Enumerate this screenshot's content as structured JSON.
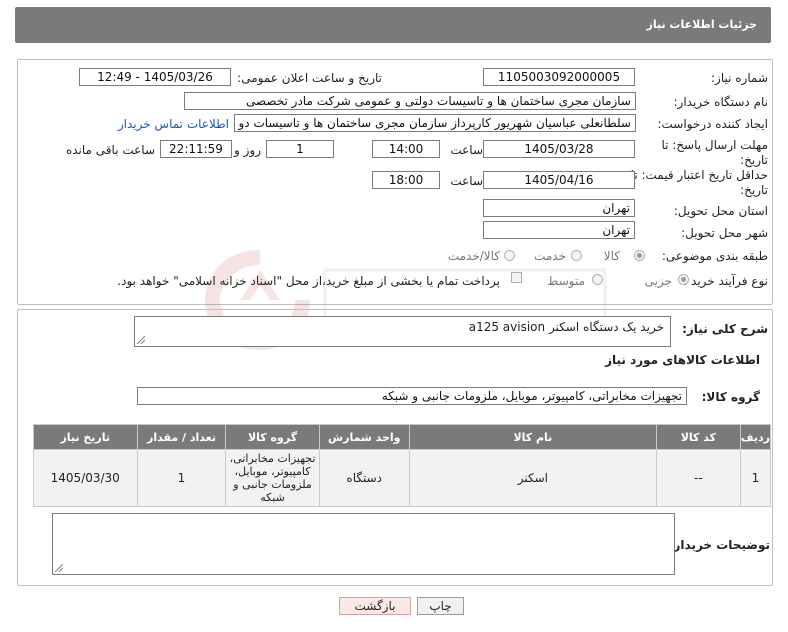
{
  "header": {
    "title": "جزئیات اطلاعات نیاز"
  },
  "fields": {
    "need_number_label": "شماره نیاز:",
    "need_number": "1105003092000005",
    "announce_label": "تاریخ و ساعت اعلان عمومی:",
    "announce_value": "1405/03/26 - 12:49",
    "buyer_label": "نام دستگاه خریدار:",
    "buyer_value": "سازمان مجری ساختمان ها و تاسیسات دولتی و عمومی  شرکت مادر تخصصی",
    "creator_label": "ایجاد کننده درخواست:",
    "creator_value": "سلطانعلی عباسیان شهریور کارپرداز سازمان مجری ساختمان ها و تاسیسات دو",
    "contact_link": "اطلاعات تماس خریدار",
    "deadline_label": "مهلت ارسال پاسخ: تا تاریخ:",
    "deadline_date": "1405/03/28",
    "time_label": "ساعت",
    "deadline_time": "14:00",
    "days_value": "1",
    "day_and_label": "روز و",
    "remaining_time": "22:11:59",
    "remaining_label": "ساعت باقی مانده",
    "validity_label": "حداقل تاریخ اعتبار قیمت: تا تاریخ:",
    "validity_date": "1405/04/16",
    "validity_time": "18:00",
    "province_label": "استان محل تحویل:",
    "province_value": "تهران",
    "city_label": "شهر محل تحویل:",
    "city_value": "تهران",
    "category_label": "طبقه بندی موضوعی:",
    "category_opt1": "کالا",
    "category_opt2": "خدمت",
    "category_opt3": "کالا/خدمت",
    "process_label": "نوع فرآیند خرید :",
    "process_opt1": "جزیی",
    "process_opt2": "متوسط",
    "payment_note": "پرداخت تمام یا بخشی از مبلغ خرید،از محل \"اسناد خزانه اسلامی\" خواهد بود."
  },
  "summary": {
    "label": "شرح کلی نیاز:",
    "value": "خرید یک دستگاه اسکنر a125 avision"
  },
  "goods_info_title": "اطلاعات کالاهای مورد نیاز",
  "goods_group": {
    "label": "گروه کالا:",
    "value": "تجهیزات مخابراتی، کامپیوتر، موبایل، ملزومات جانبی و شبکه"
  },
  "table": {
    "headers": [
      "ردیف",
      "کد کالا",
      "نام کالا",
      "واحد شمارش",
      "گروه کالا",
      "تعداد / مقدار",
      "تاریخ نیاز"
    ],
    "rows": [
      [
        "1",
        "--",
        "اسکنر",
        "دستگاه",
        "تجهیزات مخابراتی، کامپیوتر، موبایل، ملزومات جانبی و شبکه",
        "1",
        "1405/03/30"
      ]
    ]
  },
  "buyer_notes_label": "توضیحات خریدار:",
  "buttons": {
    "print": "چاپ",
    "back": "بازگشت"
  },
  "watermark_text": "AriaTender.net"
}
